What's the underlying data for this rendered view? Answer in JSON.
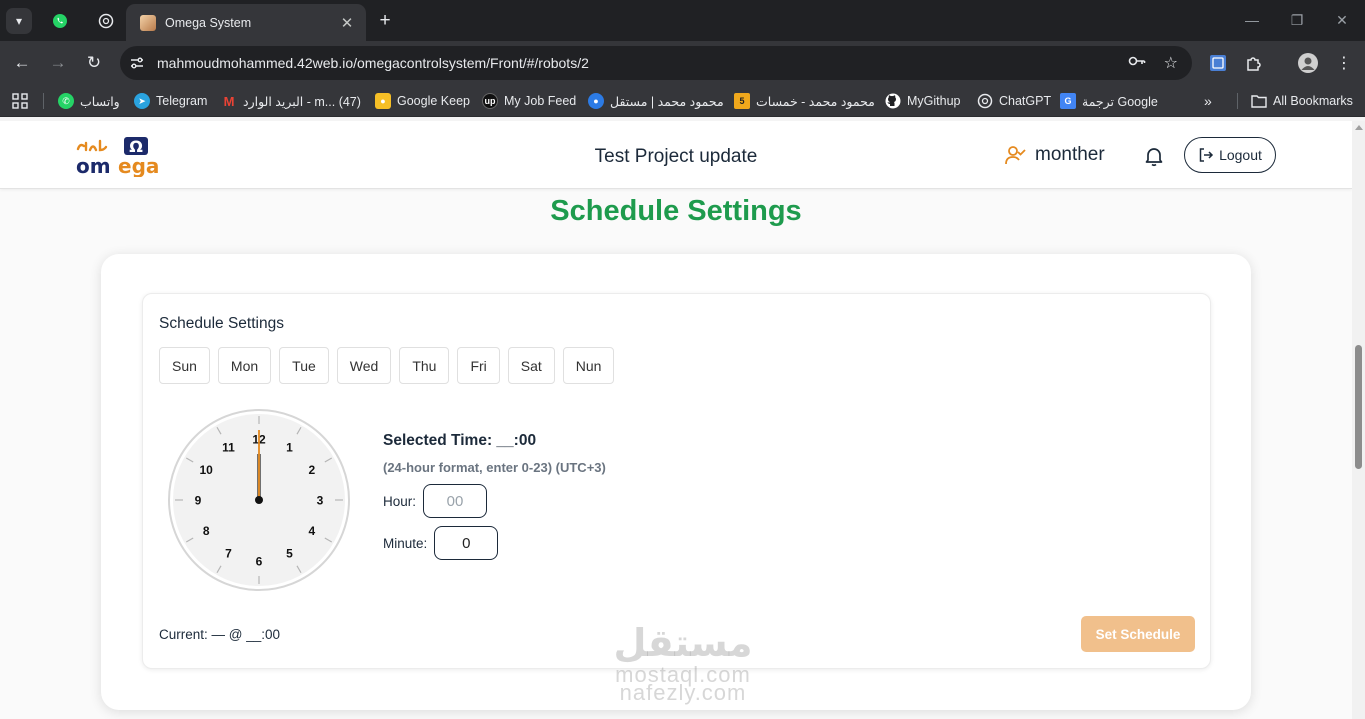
{
  "browser": {
    "active_tab_title": "Omega System",
    "url": "mahmoudmohammed.42web.io/omegacontrolsystem/Front/#/robots/2",
    "bookmarks": [
      {
        "label": "واتساب",
        "icon": "whatsapp-icon",
        "color": "#25d366"
      },
      {
        "label": "Telegram",
        "icon": "telegram-icon",
        "color": "#2aa3df"
      },
      {
        "label": "البريد الوارد - m... (47)",
        "icon": "gmail-icon",
        "color": "#ea4335"
      },
      {
        "label": "Google Keep",
        "icon": "keep-icon",
        "color": "#f6bf26"
      },
      {
        "label": "My Job Feed",
        "icon": "upwork-icon",
        "color": "#111111"
      },
      {
        "label": "محمود محمد | مستقل",
        "icon": "mostaql-icon",
        "color": "#2c7be5"
      },
      {
        "label": "محمود محمد - خمسات",
        "icon": "khamsat-icon",
        "color": "#f0a81c"
      },
      {
        "label": "MyGithup",
        "icon": "github-icon",
        "color": "#ffffff"
      },
      {
        "label": "ChatGPT",
        "icon": "chatgpt-icon",
        "color": "#ffffff"
      },
      {
        "label": "ترجمة Google",
        "icon": "translate-icon",
        "color": "#4285f4"
      }
    ],
    "all_bookmarks": "All Bookmarks"
  },
  "header": {
    "project_title": "Test Project update",
    "user_name": "monther",
    "logout_label": "Logout"
  },
  "page_heading": "Schedule Settings",
  "schedule": {
    "title": "Schedule Settings",
    "days": [
      "Sun",
      "Mon",
      "Tue",
      "Wed",
      "Thu",
      "Fri",
      "Sat",
      "Nun"
    ],
    "clock_numbers": [
      "12",
      "1",
      "2",
      "3",
      "4",
      "5",
      "6",
      "7",
      "8",
      "9",
      "10",
      "11"
    ],
    "selected_time": "Selected Time: __:00",
    "format_note": "(24-hour format, enter 0-23) (UTC+3)",
    "hour_label": "Hour:",
    "hour_placeholder": "00",
    "minute_label": "Minute:",
    "minute_value": "0",
    "current": "Current: — @ __:00",
    "set_button": "Set Schedule"
  },
  "watermark": {
    "arabic": "مستقل",
    "line1": "mostaql.com",
    "line2": "nafezly.com"
  },
  "colors": {
    "heading_green": "#1e9b4d",
    "set_button": "#f1c08c",
    "accent_orange": "#e58a1f",
    "navy": "#1c2a3a"
  }
}
